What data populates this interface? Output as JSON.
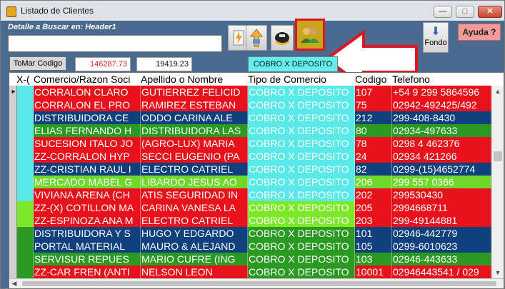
{
  "window": {
    "title": "Listado de Clientes",
    "min_glyph": "—",
    "max_glyph": "□",
    "close_glyph": "✕"
  },
  "toolbar": {
    "search_label": "Detalle a Buscar en: Header1",
    "search_value": "",
    "tool_icons": [
      "lightning-paper-icon",
      "sort-arrows-icon",
      "cap-icon",
      "users-icon"
    ],
    "fondo_label": "Fondo",
    "ayuda_label": "Ayuda ?"
  },
  "status": {
    "tomar_label": "ToMar Codigo",
    "total_1": "146287.73",
    "total_2": "19419.23",
    "cobro_label": "COBRO X DEPOSITO"
  },
  "grid": {
    "headers": [
      "X-(",
      "Comercio/Razon Soci",
      "Apellido o Nombre",
      "Tipo de Comercio",
      "Codigo",
      "Telefono"
    ],
    "rows": [
      {
        "comercio": "CORRALON CLARO",
        "apellido": "GUTIERREZ FELICID",
        "tipo": "COBRO X DEPOSITO",
        "codigo": "107",
        "telefono": "+54 9 299 5864596",
        "bg": "#e8121c",
        "tipo_bg": "#5ae8e8",
        "sel": "▸"
      },
      {
        "comercio": "CORRALON EL PRO",
        "apellido": "RAMIREZ ESTEBAN",
        "tipo": "COBRO X DEPOSITO",
        "codigo": "75",
        "telefono": "02942-492425/492",
        "bg": "#e8121c",
        "tipo_bg": "#5ae8e8",
        "sel": ""
      },
      {
        "comercio": "DISTRIBUIDORA CE",
        "apellido": "ODDO CARINA ALE",
        "tipo": "COBRO X DEPOSITO",
        "codigo": "212",
        "telefono": "299-408-8430",
        "bg": "#11407e",
        "tipo_bg": "#5ae8e8",
        "sel": ""
      },
      {
        "comercio": "ELIAS FERNANDO H",
        "apellido": "DISTRIBUIDORA LAS",
        "tipo": "COBRO X DEPOSITO",
        "codigo": "80",
        "telefono": "02934-497633",
        "bg": "#2b9a22",
        "tipo_bg": "#5ae8e8",
        "sel": ""
      },
      {
        "comercio": "SUCESION ITALO JO",
        "apellido": "(AGRO-LUX) MARIA",
        "tipo": "COBRO X DEPOSITO",
        "codigo": "78",
        "telefono": "0298 4 462376",
        "bg": "#e8121c",
        "tipo_bg": "#5ae8e8",
        "sel": ""
      },
      {
        "comercio": "ZZ-CORRALON HYP",
        "apellido": "SECCI EUGENIO (PA",
        "tipo": "COBRO X DEPOSITO",
        "codigo": "24",
        "telefono": "02934 421266",
        "bg": "#e8121c",
        "tipo_bg": "#5ae8e8",
        "sel": ""
      },
      {
        "comercio": "ZZ-CRISTIAN RAUL I",
        "apellido": "ELECTRO CATRIEL",
        "tipo": "COBRO X DEPOSITO",
        "codigo": "82",
        "telefono": "0299-(15)4652774",
        "bg": "#11407e",
        "tipo_bg": "#5ae8e8",
        "sel": ""
      },
      {
        "comercio": "MERCADO MABEL G",
        "apellido": "LIBARDO JESUS AO",
        "tipo": "COBRO X DEPOSITO",
        "codigo": "206",
        "telefono": "299 557 0366",
        "bg": "#6fd82a",
        "tipo_bg": "#5ae8e8",
        "sel": ""
      },
      {
        "comercio": "VIVIANA ARENA (CH",
        "apellido": "ATIS SEGURIDAD IN",
        "tipo": "COBRO X DEPOSITO",
        "codigo": "202",
        "telefono": "299530430",
        "bg": "#e8121c",
        "tipo_bg": "#5ae8e8",
        "sel": ""
      },
      {
        "comercio": "ZZ-(X) COTILLON MA",
        "apellido": "CARINA VANESA LA",
        "tipo": "COBRO X DEPOSITO",
        "codigo": "205",
        "telefono": "2994668711",
        "bg": "#e8121c",
        "tipo_bg": "#7ee82a",
        "sel": ""
      },
      {
        "comercio": "ZZ-ESPINOZA ANA M",
        "apellido": "ELECTRO CATRIEL",
        "tipo": "COBRO X DEPOSITO",
        "codigo": "203",
        "telefono": "299-49144881",
        "bg": "#e8121c",
        "tipo_bg": "#7ee82a",
        "sel": ""
      },
      {
        "comercio": "DISTRIBUIDORA Y S",
        "apellido": "HUGO Y EDGARDO",
        "tipo": "COBRO X DEPOSITO",
        "codigo": "101",
        "telefono": "02946-442779",
        "bg": "#11407e",
        "tipo_bg": "#2b9a22",
        "sel": ""
      },
      {
        "comercio": "PORTAL MATERIAL",
        "apellido": "MAURO & ALEJAND",
        "tipo": "COBRO X DEPOSITO",
        "codigo": "105",
        "telefono": "0299-6010623",
        "bg": "#11407e",
        "tipo_bg": "#2b9a22",
        "sel": ""
      },
      {
        "comercio": "SERVISUR REPUES",
        "apellido": "MARIO CUFRE (ING",
        "tipo": "COBRO X DEPOSITO",
        "codigo": "103",
        "telefono": "02946-443633",
        "bg": "#2b9a22",
        "tipo_bg": "#2b9a22",
        "sel": ""
      },
      {
        "comercio": "ZZ-CAR FREN (ANTI",
        "apellido": "NELSON LEON",
        "tipo": "COBRO X DEPOSITO",
        "codigo": "10001",
        "telefono": "02946443541 / 029",
        "bg": "#e8121c",
        "tipo_bg": "#2b9a22",
        "sel": ""
      }
    ]
  },
  "colors": {
    "red_row": "#e8121c",
    "blue_row": "#11407e",
    "green_row": "#2b9a22",
    "lime_row": "#6fd82a",
    "cyan_tipo": "#5ae8e8",
    "highlight_border": "#e0141c"
  }
}
